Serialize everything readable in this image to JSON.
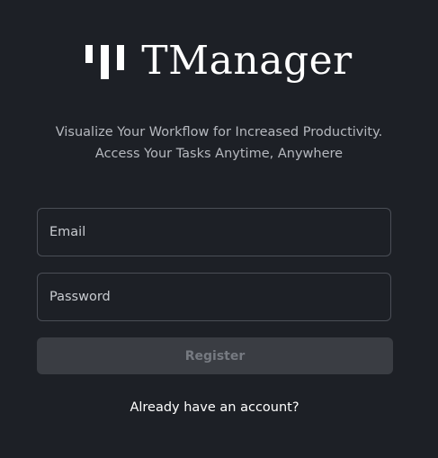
{
  "brand": {
    "name": "TManager",
    "logo_icon": "tmanager-logo-icon"
  },
  "tagline": {
    "line1": "Visualize Your Workflow for Increased Productivity.",
    "line2": "Access Your Tasks Anytime, Anywhere"
  },
  "form": {
    "email_placeholder": "Email",
    "email_value": "",
    "password_placeholder": "Password",
    "password_value": "",
    "register_label": "Register",
    "register_enabled": false
  },
  "login_link": {
    "label": "Already have an account?"
  },
  "colors": {
    "background": "#1d2026",
    "text_primary": "#ffffff",
    "text_muted": "#b6b9bf",
    "field_border": "#4a4e56",
    "button_disabled_bg": "#3a3d43",
    "button_disabled_text": "#767a81"
  }
}
